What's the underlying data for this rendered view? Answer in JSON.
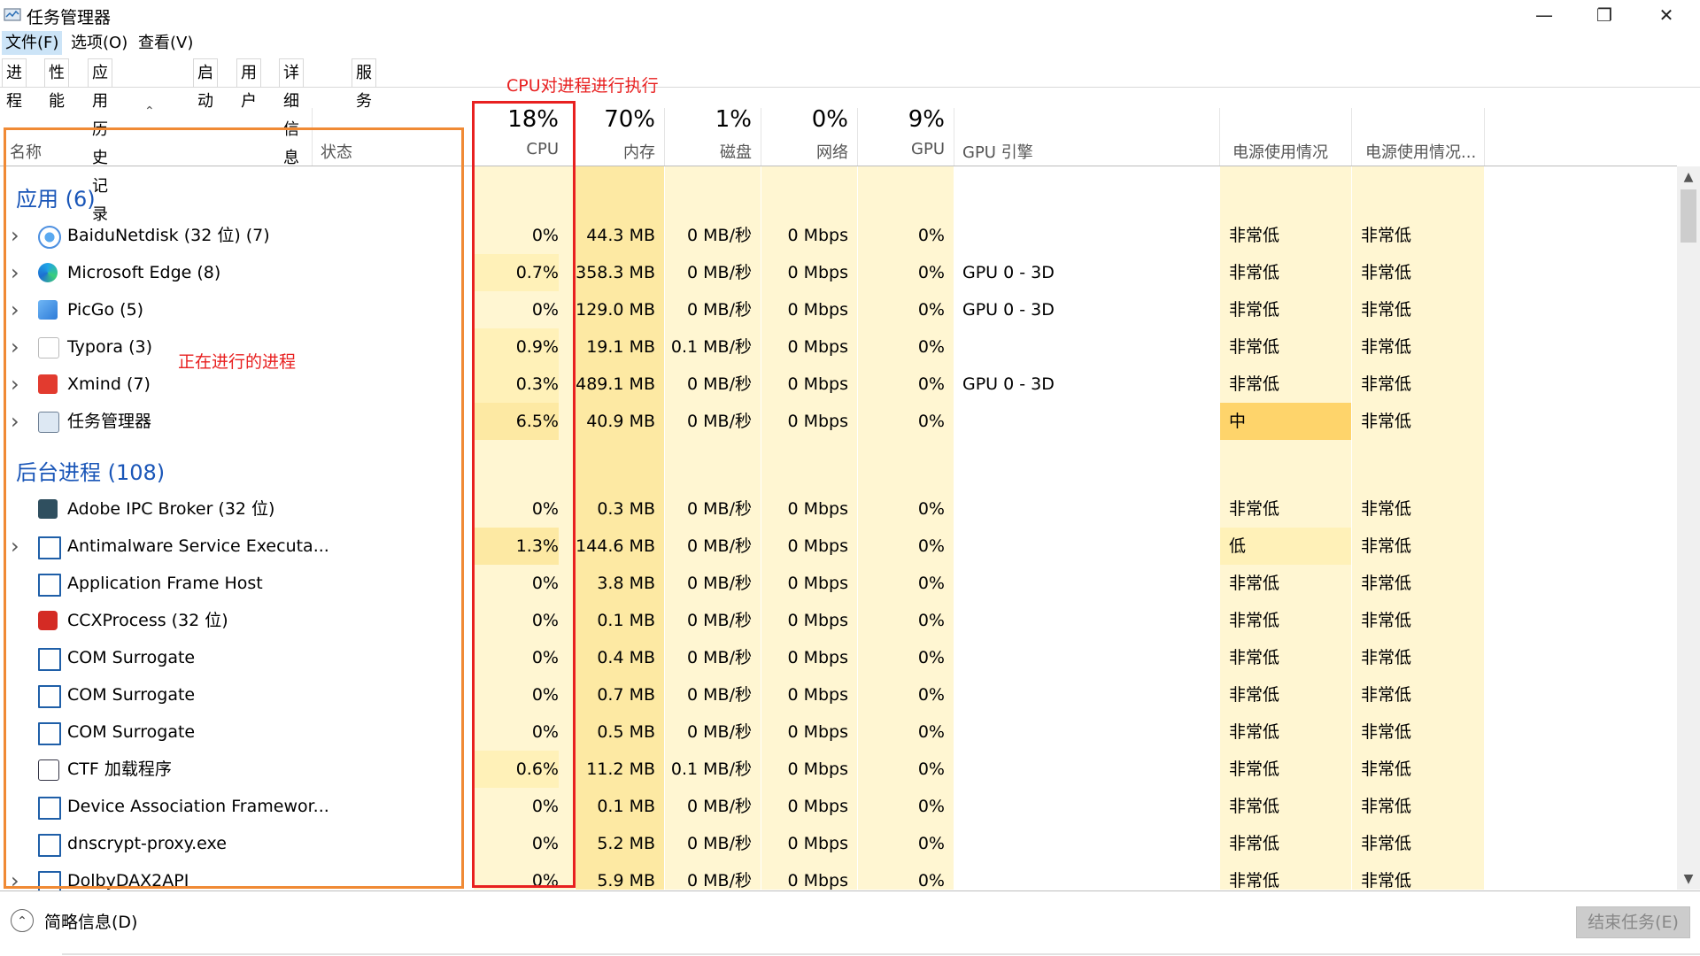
{
  "window": {
    "title": "任务管理器",
    "icon": "task-manager-icon",
    "minimize_glyph": "—",
    "restore_glyph": "❐",
    "close_glyph": "✕"
  },
  "menu": [
    "文件(F)",
    "选项(O)",
    "查看(V)"
  ],
  "tabs": [
    "进程",
    "性能",
    "应用历史记录",
    "启动",
    "用户",
    "详细信息",
    "服务"
  ],
  "header": {
    "name": "名称",
    "status": "状态",
    "cpu_pct": "18%",
    "cpu": "CPU",
    "mem_pct": "70%",
    "mem": "内存",
    "disk_pct": "1%",
    "disk": "磁盘",
    "net_pct": "0%",
    "net": "网络",
    "gpu_pct": "9%",
    "gpu": "GPU",
    "gpu_engine": "GPU 引擎",
    "power": "电源使用情况",
    "power_trend": "电源使用情况..."
  },
  "annotations": {
    "cpu": "CPU对进程进行执行",
    "processes": "正在进行的进程"
  },
  "groups": {
    "apps": "应用 (6)",
    "background": "后台进程 (108)"
  },
  "apps": [
    {
      "name": "BaiduNetdisk (32 位) (7)",
      "icon": "baidunetdisk-icon",
      "expand": true,
      "cpu": "0%",
      "mem": "44.3 MB",
      "disk": "0 MB/秒",
      "net": "0 Mbps",
      "gpu": "0%",
      "engine": "",
      "power": "非常低",
      "trend": "非常低"
    },
    {
      "name": "Microsoft Edge (8)",
      "icon": "edge-icon",
      "expand": true,
      "cpu": "0.7%",
      "mem": "358.3 MB",
      "disk": "0 MB/秒",
      "net": "0 Mbps",
      "gpu": "0%",
      "engine": "GPU 0 - 3D",
      "power": "非常低",
      "trend": "非常低"
    },
    {
      "name": "PicGo (5)",
      "icon": "picgo-icon",
      "expand": true,
      "cpu": "0%",
      "mem": "129.0 MB",
      "disk": "0 MB/秒",
      "net": "0 Mbps",
      "gpu": "0%",
      "engine": "GPU 0 - 3D",
      "power": "非常低",
      "trend": "非常低"
    },
    {
      "name": "Typora (3)",
      "icon": "typora-icon",
      "expand": true,
      "cpu": "0.9%",
      "mem": "19.1 MB",
      "disk": "0.1 MB/秒",
      "net": "0 Mbps",
      "gpu": "0%",
      "engine": "",
      "power": "非常低",
      "trend": "非常低"
    },
    {
      "name": "Xmind (7)",
      "icon": "xmind-icon",
      "expand": true,
      "cpu": "0.3%",
      "mem": "489.1 MB",
      "disk": "0 MB/秒",
      "net": "0 Mbps",
      "gpu": "0%",
      "engine": "GPU 0 - 3D",
      "power": "非常低",
      "trend": "非常低"
    },
    {
      "name": "任务管理器",
      "icon": "task-manager-icon",
      "expand": true,
      "cpu": "6.5%",
      "mem": "40.9 MB",
      "disk": "0 MB/秒",
      "net": "0 Mbps",
      "gpu": "0%",
      "engine": "",
      "power": "中",
      "trend": "非常低"
    }
  ],
  "background": [
    {
      "name": "Adobe IPC Broker (32 位)",
      "icon": "adobe-ipc-icon",
      "expand": false,
      "cpu": "0%",
      "mem": "0.3 MB",
      "disk": "0 MB/秒",
      "net": "0 Mbps",
      "gpu": "0%",
      "engine": "",
      "power": "非常低",
      "trend": "非常低"
    },
    {
      "name": "Antimalware Service Executa...",
      "icon": "window-app-icon",
      "expand": true,
      "cpu": "1.3%",
      "mem": "144.6 MB",
      "disk": "0 MB/秒",
      "net": "0 Mbps",
      "gpu": "0%",
      "engine": "",
      "power": "低",
      "trend": "非常低"
    },
    {
      "name": "Application Frame Host",
      "icon": "window-app-icon",
      "expand": false,
      "cpu": "0%",
      "mem": "3.8 MB",
      "disk": "0 MB/秒",
      "net": "0 Mbps",
      "gpu": "0%",
      "engine": "",
      "power": "非常低",
      "trend": "非常低"
    },
    {
      "name": "CCXProcess (32 位)",
      "icon": "ccx-icon",
      "expand": false,
      "cpu": "0%",
      "mem": "0.1 MB",
      "disk": "0 MB/秒",
      "net": "0 Mbps",
      "gpu": "0%",
      "engine": "",
      "power": "非常低",
      "trend": "非常低"
    },
    {
      "name": "COM Surrogate",
      "icon": "window-app-icon",
      "expand": false,
      "cpu": "0%",
      "mem": "0.4 MB",
      "disk": "0 MB/秒",
      "net": "0 Mbps",
      "gpu": "0%",
      "engine": "",
      "power": "非常低",
      "trend": "非常低"
    },
    {
      "name": "COM Surrogate",
      "icon": "window-app-icon",
      "expand": false,
      "cpu": "0%",
      "mem": "0.7 MB",
      "disk": "0 MB/秒",
      "net": "0 Mbps",
      "gpu": "0%",
      "engine": "",
      "power": "非常低",
      "trend": "非常低"
    },
    {
      "name": "COM Surrogate",
      "icon": "window-app-icon",
      "expand": false,
      "cpu": "0%",
      "mem": "0.5 MB",
      "disk": "0 MB/秒",
      "net": "0 Mbps",
      "gpu": "0%",
      "engine": "",
      "power": "非常低",
      "trend": "非常低"
    },
    {
      "name": "CTF 加载程序",
      "icon": "ctf-loader-icon",
      "expand": false,
      "cpu": "0.6%",
      "mem": "11.2 MB",
      "disk": "0.1 MB/秒",
      "net": "0 Mbps",
      "gpu": "0%",
      "engine": "",
      "power": "非常低",
      "trend": "非常低"
    },
    {
      "name": "Device Association Framewor...",
      "icon": "window-app-icon",
      "expand": false,
      "cpu": "0%",
      "mem": "0.1 MB",
      "disk": "0 MB/秒",
      "net": "0 Mbps",
      "gpu": "0%",
      "engine": "",
      "power": "非常低",
      "trend": "非常低"
    },
    {
      "name": "dnscrypt-proxy.exe",
      "icon": "window-app-icon",
      "expand": false,
      "cpu": "0%",
      "mem": "5.2 MB",
      "disk": "0 MB/秒",
      "net": "0 Mbps",
      "gpu": "0%",
      "engine": "",
      "power": "非常低",
      "trend": "非常低"
    },
    {
      "name": "DolbyDAX2API",
      "icon": "window-app-icon",
      "expand": true,
      "cpu": "0%",
      "mem": "5.9 MB",
      "disk": "0 MB/秒",
      "net": "0 Mbps",
      "gpu": "0%",
      "engine": "",
      "power": "非常低",
      "trend": "非常低"
    }
  ],
  "footer": {
    "fewer_details": "简略信息(D)",
    "end_task": "结束任务(E)"
  },
  "colors": {
    "light": "#fff8d8",
    "medium": "#fff1b8",
    "mem": "#fdeba6",
    "high": "#fed46b",
    "group_title": "#1a56b8"
  }
}
